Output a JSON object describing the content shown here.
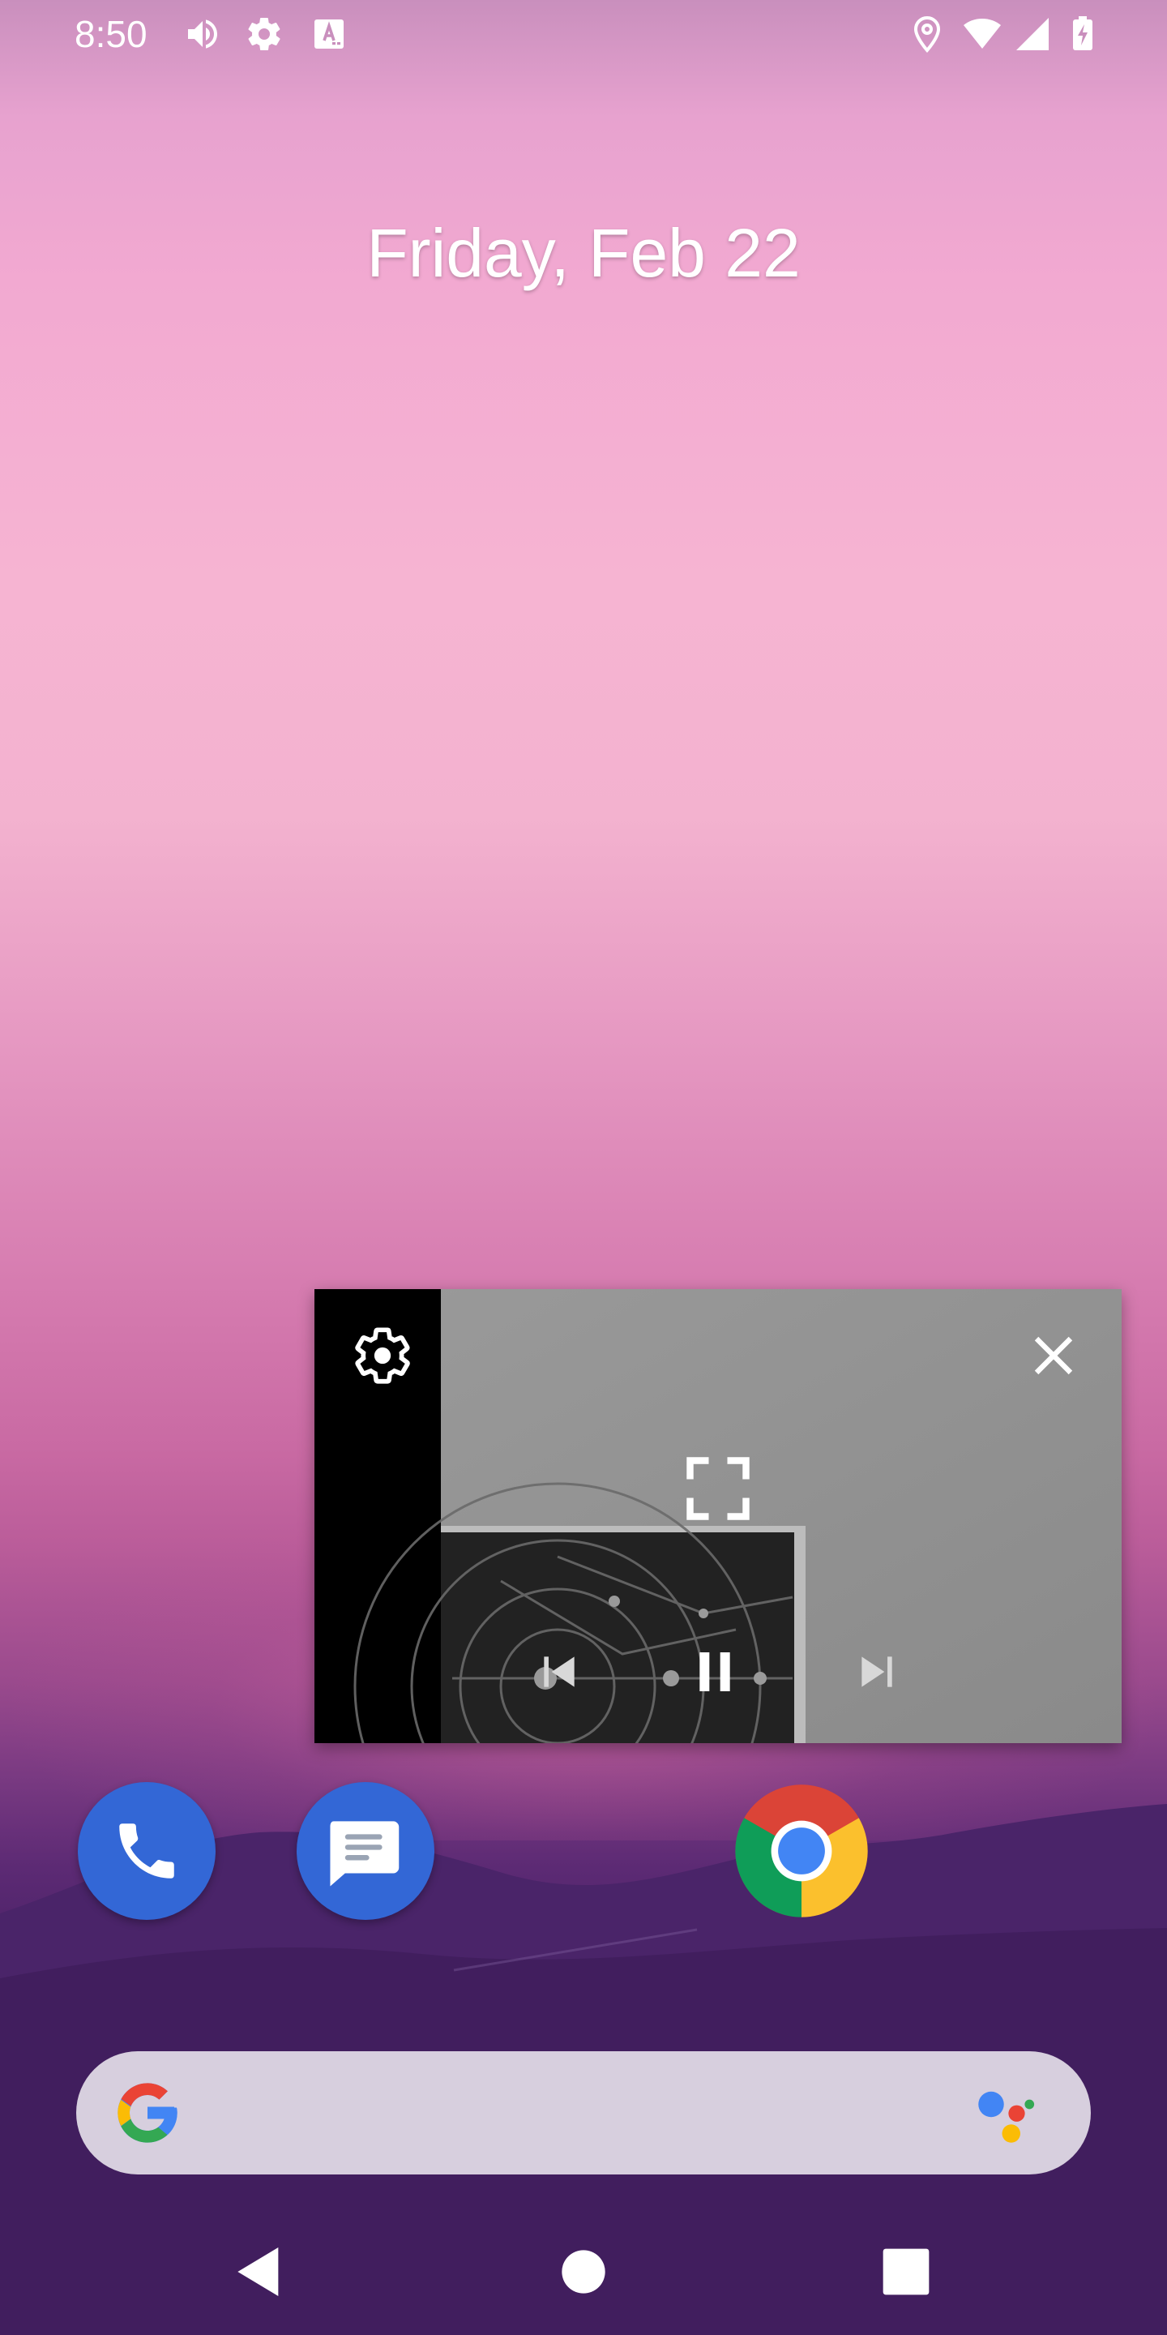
{
  "status_bar": {
    "time": "8:50",
    "left_icons": [
      "volume-icon",
      "settings-icon",
      "keyboard-a-icon"
    ],
    "right_icons": [
      "location-icon",
      "wifi-icon",
      "cell-signal-icon",
      "battery-charging-icon"
    ]
  },
  "home": {
    "date": "Friday, Feb 22"
  },
  "pip_player": {
    "controls": [
      "settings-icon",
      "close-icon",
      "fullscreen-icon",
      "skip-previous-icon",
      "pause-icon",
      "skip-next-icon"
    ]
  },
  "dock": {
    "apps": [
      {
        "name": "Phone",
        "icon": "phone-icon"
      },
      {
        "name": "Messages",
        "icon": "messages-icon"
      },
      {
        "name": "Chrome",
        "icon": "chrome-icon"
      }
    ]
  },
  "search": {
    "placeholder": "",
    "left_icon": "google-g-icon",
    "right_icon": "google-assistant-icon"
  },
  "nav": {
    "buttons": [
      "back-icon",
      "home-icon",
      "recents-icon"
    ]
  },
  "colors": {
    "phone_blue": "#3367d6",
    "messages_blue": "#3367d6",
    "search_bg": "#ece8f0",
    "pip_sidebar": "#000000"
  }
}
